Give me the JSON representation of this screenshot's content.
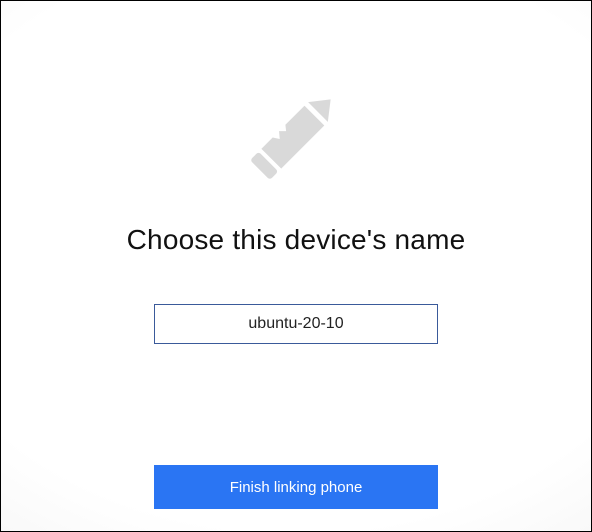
{
  "dialog": {
    "heading": "Choose this device's name",
    "device_name_value": "ubuntu-20-10",
    "finish_button_label": "Finish linking phone",
    "icon": "pencil-icon",
    "colors": {
      "accent": "#2a75f3",
      "input_border": "#3a5a9a",
      "icon_fill": "#d9d9d9"
    }
  }
}
